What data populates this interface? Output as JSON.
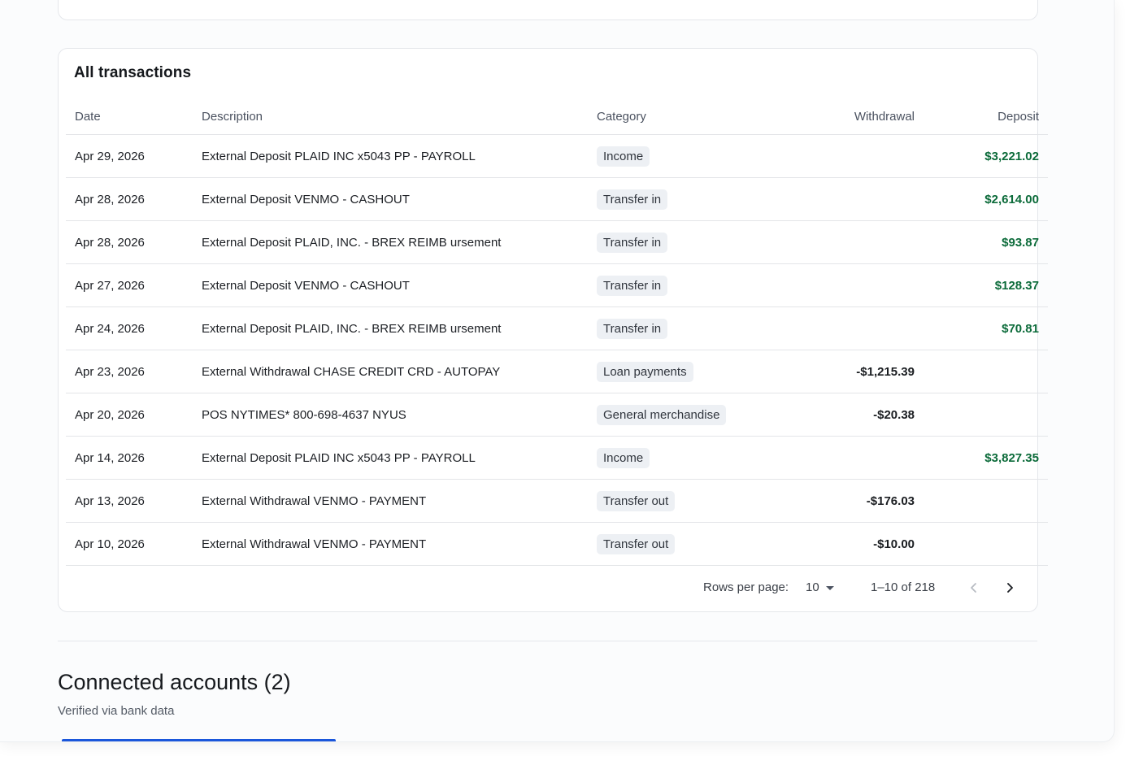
{
  "transactions": {
    "title": "All transactions",
    "columns": {
      "date": "Date",
      "description": "Description",
      "category": "Category",
      "withdrawal": "Withdrawal",
      "deposit": "Deposit"
    },
    "rows": [
      {
        "date": "Apr 29, 2026",
        "description": "External Deposit PLAID INC x5043 PP - PAYROLL",
        "category": "Income",
        "withdrawal": "",
        "deposit": "$3,221.02"
      },
      {
        "date": "Apr 28, 2026",
        "description": "External Deposit VENMO - CASHOUT",
        "category": "Transfer in",
        "withdrawal": "",
        "deposit": "$2,614.00"
      },
      {
        "date": "Apr 28, 2026",
        "description": "External Deposit PLAID, INC. - BREX REIMB ursement",
        "category": "Transfer in",
        "withdrawal": "",
        "deposit": "$93.87"
      },
      {
        "date": "Apr 27, 2026",
        "description": "External Deposit VENMO - CASHOUT",
        "category": "Transfer in",
        "withdrawal": "",
        "deposit": "$128.37"
      },
      {
        "date": "Apr 24, 2026",
        "description": "External Deposit PLAID, INC. - BREX REIMB ursement",
        "category": "Transfer in",
        "withdrawal": "",
        "deposit": "$70.81"
      },
      {
        "date": "Apr 23, 2026",
        "description": "External Withdrawal CHASE CREDIT CRD - AUTOPAY",
        "category": "Loan payments",
        "withdrawal": "-$1,215.39",
        "deposit": ""
      },
      {
        "date": "Apr 20, 2026",
        "description": "POS NYTIMES* 800-698-4637 NYUS",
        "category": "General merchandise",
        "withdrawal": "-$20.38",
        "deposit": ""
      },
      {
        "date": "Apr 14, 2026",
        "description": "External Deposit PLAID INC x5043 PP - PAYROLL",
        "category": "Income",
        "withdrawal": "",
        "deposit": "$3,827.35"
      },
      {
        "date": "Apr 13, 2026",
        "description": "External Withdrawal VENMO - PAYMENT",
        "category": "Transfer out",
        "withdrawal": "-$176.03",
        "deposit": ""
      },
      {
        "date": "Apr 10, 2026",
        "description": "External Withdrawal VENMO - PAYMENT",
        "category": "Transfer out",
        "withdrawal": "-$10.00",
        "deposit": ""
      }
    ],
    "pagination": {
      "rows_per_page_label": "Rows per page:",
      "rows_per_page": "10",
      "range": "1–10 of 218"
    }
  },
  "connected_accounts": {
    "title": "Connected accounts (2)",
    "subtitle": "Verified via bank data"
  },
  "colors": {
    "deposit": "#0c6b3a",
    "badge_bg": "#edf0f4",
    "accent": "#1a56db"
  },
  "icons": {
    "prev": "chevron-left-icon",
    "next": "chevron-right-icon",
    "dropdown": "caret-down-icon"
  }
}
